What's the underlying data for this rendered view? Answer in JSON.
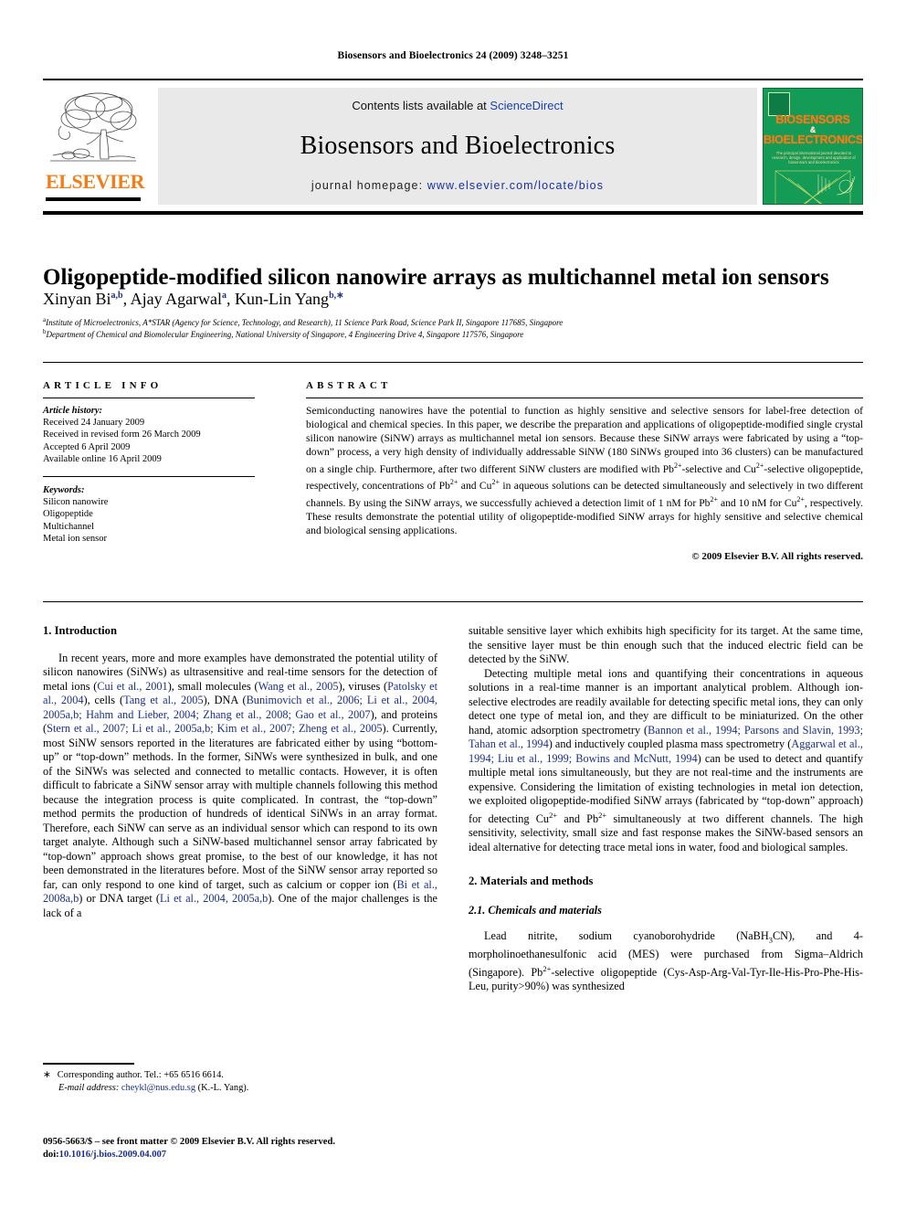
{
  "running_head": "Biosensors and Bioelectronics 24 (2009) 3248–3251",
  "masthead": {
    "contents_prefix": "Contents lists available at ",
    "sciencedirect": "ScienceDirect",
    "journal_name": "Biosensors and Bioelectronics",
    "homepage_label": "journal homepage:",
    "homepage_url": "www.elsevier.com/locate/bios",
    "publisher": "ELSEVIER",
    "cover": {
      "title_line1": "BIOSENSORS",
      "amp": "&",
      "title_line2": "BIOELECTRONICS",
      "subtitle": "The principal international journal devoted to research, design, development and application of biosensors and bioelectronics"
    },
    "accent_orange": "#f07f1a",
    "accent_blue": "#1a3fb0",
    "cover_green": "#149b56"
  },
  "title": "Oligopeptide-modified silicon nanowire arrays as multichannel metal ion sensors",
  "authors": [
    {
      "name": "Xinyan Bi",
      "sup": "a,b"
    },
    {
      "name": "Ajay Agarwal",
      "sup": "a"
    },
    {
      "name": "Kun-Lin Yang",
      "sup": "b,∗"
    }
  ],
  "affiliations": [
    {
      "marker": "a",
      "text": "Institute of Microelectronics, A*STAR (Agency for Science, Technology, and Research), 11 Science Park Road, Science Park II, Singapore 117685, Singapore"
    },
    {
      "marker": "b",
      "text": "Department of Chemical and Biomolecular Engineering, National University of Singapore, 4 Engineering Drive 4, Singapore 117576, Singapore"
    }
  ],
  "article_info": {
    "heading": "ARTICLE INFO",
    "history_label": "Article history:",
    "history": [
      "Received 24 January 2009",
      "Received in revised form 26 March 2009",
      "Accepted 6 April 2009",
      "Available online 16 April 2009"
    ],
    "keywords_label": "Keywords:",
    "keywords": [
      "Silicon nanowire",
      "Oligopeptide",
      "Multichannel",
      "Metal ion sensor"
    ]
  },
  "abstract": {
    "heading": "ABSTRACT",
    "paragraphs": [
      "Semiconducting nanowires have the potential to function as highly sensitive and selective sensors for label-free detection of biological and chemical species. In this paper, we describe the preparation and applications of oligopeptide-modified single crystal silicon nanowire (SiNW) arrays as multichannel metal ion sensors. Because these SiNW arrays were fabricated by using a “top-down” process, a very high density of individually addressable SiNW (180 SiNWs grouped into 36 clusters) can be manufactured on a single chip. Furthermore, after two different SiNW clusters are modified with Pb2+-selective and Cu2+-selective oligopeptide, respectively, concentrations of Pb2+ and Cu2+ in aqueous solutions can be detected simultaneously and selectively in two different channels. By using the SiNW arrays, we successfully achieved a detection limit of 1 nM for Pb2+ and 10 nM for Cu2+, respectively. These results demonstrate the potential utility of oligopeptide-modified SiNW arrays for highly sensitive and selective chemical and biological sensing applications."
    ],
    "copyright": "© 2009 Elsevier B.V. All rights reserved."
  },
  "body": {
    "intro_heading": "1.  Introduction",
    "left_paragraphs": [
      "In recent years, more and more examples have demonstrated the potential utility of silicon nanowires (SiNWs) as ultrasensitive and real-time sensors for the detection of metal ions (Cui et al., 2001), small molecules (Wang et al., 2005), viruses (Patolsky et al., 2004), cells (Tang et al., 2005), DNA (Bunimovich et al., 2006; Li et al., 2004, 2005a,b; Hahm and Lieber, 2004; Zhang et al., 2008; Gao et al., 2007), and proteins (Stern et al., 2007; Li et al., 2005a,b; Kim et al., 2007; Zheng et al., 2005). Currently, most SiNW sensors reported in the literatures are fabricated either by using “bottom-up” or “top-down” methods. In the former, SiNWs were synthesized in bulk, and one of the SiNWs was selected and connected to metallic contacts. However, it is often difficult to fabricate a SiNW sensor array with multiple channels following this method because the integration process is quite complicated. In contrast, the “top-down” method permits the production of hundreds of identical SiNWs in an array format. Therefore, each SiNW can serve as an individual sensor which can respond to its own target analyte. Although such a SiNW-based multichannel sensor array fabricated by “top-down” approach shows great promise, to the best of our knowledge, it has not been demonstrated in the literatures before. Most of the SiNW sensor array reported so far, can only respond to one kind of target, such as calcium or copper ion (Bi et al., 2008a,b) or DNA target (Li et al., 2004, 2005a,b). One of the major challenges is the lack of a"
    ],
    "right_paragraph_1": "suitable sensitive layer which exhibits high specificity for its target. At the same time, the sensitive layer must be thin enough such that the induced electric field can be detected by the SiNW.",
    "right_paragraph_2": "Detecting multiple metal ions and quantifying their concentrations in aqueous solutions in a real-time manner is an important analytical problem. Although ion-selective electrodes are readily available for detecting specific metal ions, they can only detect one type of metal ion, and they are difficult to be miniaturized. On the other hand, atomic adsorption spectrometry (Bannon et al., 1994; Parsons and Slavin, 1993; Tahan et al., 1994) and inductively coupled plasma mass spectrometry (Aggarwal et al., 1994; Liu et al., 1999; Bowins and McNutt, 1994) can be used to detect and quantify multiple metal ions simultaneously, but they are not real-time and the instruments are expensive. Considering the limitation of existing technologies in metal ion detection, we exploited oligopeptide-modified SiNW arrays (fabricated by “top-down” approach) for detecting Cu2+ and Pb2+ simultaneously at two different channels. The high sensitivity, selectivity, small size and fast response makes the SiNW-based sensors an ideal alternative for detecting trace metal ions in water, food and biological samples.",
    "materials_heading": "2.  Materials and methods",
    "chemicals_heading": "2.1.  Chemicals and materials",
    "chemicals_paragraph": "Lead nitrite, sodium cyanoborohydride (NaBH3CN), and 4-morpholinoethanesulfonic acid (MES) were purchased from Sigma–Aldrich (Singapore). Pb2+-selective oligopeptide (Cys-Asp-Arg-Val-Tyr-Ile-His-Pro-Phe-His-Leu, purity>90%) was synthesized"
  },
  "footnotes": {
    "corresponding_marker": "∗",
    "corresponding_text": "Corresponding author. Tel.: +65 6516 6614.",
    "email_label": "E-mail address:",
    "email": "cheykl@nus.edu.sg",
    "email_owner": "(K.-L. Yang).",
    "issn_line": "0956-5663/$ – see front matter © 2009 Elsevier B.V. All rights reserved.",
    "doi_label": "doi:",
    "doi": "10.1016/j.bios.2009.04.007"
  }
}
